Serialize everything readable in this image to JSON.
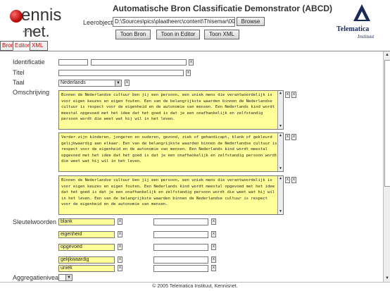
{
  "header": {
    "title": "Automatische Bron Classificatie Demonstrator (ABCD)",
    "learnobject_label": "Leerobject",
    "learnobject_value": "D:\\Sources\\pics\\plaatheerc\\content\\Thisemar\\00-Zy",
    "browse_label": "Browse",
    "show_source_label": "Toon Bron",
    "show_editor_label": "Toon in Editor",
    "show_xml_label": "Toon XML",
    "logo_left": {
      "line1": "ennis",
      "line2": "net."
    },
    "logo_right": {
      "line1": "Telematica",
      "line2": "Instituut"
    }
  },
  "tabs": [
    {
      "label": "Bron",
      "active": false
    },
    {
      "label": "Editor",
      "active": true
    },
    {
      "label": "XML",
      "active": false
    }
  ],
  "form": {
    "identificatie_label": "Identificatie",
    "titel_label": "Titel",
    "taal_label": "Taal",
    "taal_value": "Nederlands",
    "omschrijving_label": "Omschrijving",
    "omschrijving": [
      "Binnen de Nederlandse cultuur ben jij een persoon, een uniek mens die verantwoordelijk is voor eigen keuzes en eigen fouten. Een van de belangrijkste waarden binnen de Nederlandse cultuur is respect voor de eigenheid en de autonomie van mensen. Een Nederlands kind wordt meestal opgevoed met het idee dat het goed is dat je een onafhankelijk en zelfstandig persoon wordt die weet wat hij wil in het leven.",
      "Verder zijn kinderen, jongeren en ouderen, gezond, ziek of gehandicapt, blank of gekleurd gelijkwaardig aan elkaar. Een van de belangrijkste waarden binnen de Nederlandse cultuur is respect voor de eigenheid en de autonomie van mensen. Een Nederlands kind wordt meestal opgevoed met het idee dat het goed is dat je een onafhankelijk en zelfstandig persoon wordt die weet wat hij wil in het leven.",
      "Binnen de Nederlandse cultuur ben jij een persoon, een uniek mens die verantwoordelijk is voor eigen keuzes en eigen fouten. Een Nederlands kind wordt meestal opgevoed met het idee dat het goed is dat je een onafhankelijk en zelfstandig persoon wordt die weet wat hij wil in het leven. Een van de belangrijkste waarden binnen de Nederlandse cultuur is respect voor de eigenheid en de autonomie van mensen."
    ],
    "sleutelwoorden_label": "Sleutelwoorden",
    "sleutelwoorden": [
      "blank",
      "eigenheid",
      "opgevoed",
      "gelijkwaardig",
      "uniek"
    ],
    "aggregatie_label": "Aggregatieniveau",
    "x_label": "x"
  },
  "footer": {
    "text": "© 2005 Telematica Instituut, Kennisnet."
  }
}
